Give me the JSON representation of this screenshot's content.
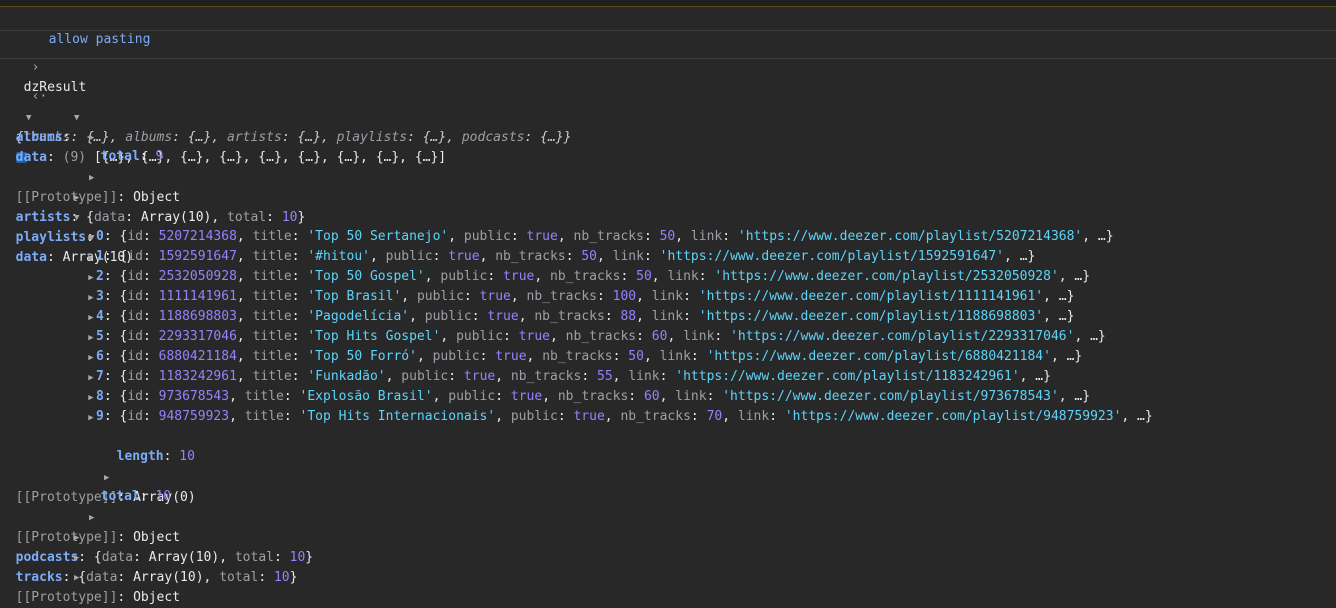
{
  "console": {
    "line1": "allow pasting",
    "line2": "dzResult",
    "summary": {
      "tracks_key": "tracks",
      "albums_key": "albums",
      "artists_key": "artists",
      "playlists_key": "playlists",
      "podcasts_key": "podcasts",
      "ellipsis": "{…}"
    },
    "albums": {
      "key": "albums",
      "data_count": "(9)",
      "data_preview": "[{…}, {…}, {…}, {…}, {…}, {…}, {…}, {…}, {…}]",
      "total": "9"
    },
    "artists": {
      "key": "artists",
      "preview_data": "Array(10)",
      "total": "10"
    },
    "playlists": {
      "key": "playlists",
      "data_label": "Array(10)",
      "items": [
        {
          "idx": "0",
          "id": "5207214368",
          "title": "'Top 50 Sertanejo'",
          "public": "true",
          "nb": "50",
          "link": "'https://www.deezer.com/playlist/5207214368'"
        },
        {
          "idx": "1",
          "id": "1592591647",
          "title": "'#hitou'",
          "public": "true",
          "nb": "50",
          "link": "'https://www.deezer.com/playlist/1592591647'"
        },
        {
          "idx": "2",
          "id": "2532050928",
          "title": "'Top 50 Gospel'",
          "public": "true",
          "nb": "50",
          "link": "'https://www.deezer.com/playlist/2532050928'"
        },
        {
          "idx": "3",
          "id": "1111141961",
          "title": "'Top Brasil'",
          "public": "true",
          "nb": "100",
          "link": "'https://www.deezer.com/playlist/1111141961'"
        },
        {
          "idx": "4",
          "id": "1188698803",
          "title": "'Pagodelícia'",
          "public": "true",
          "nb": "88",
          "link": "'https://www.deezer.com/playlist/1188698803'"
        },
        {
          "idx": "5",
          "id": "2293317046",
          "title": "'Top Hits Gospel'",
          "public": "true",
          "nb": "60",
          "link": "'https://www.deezer.com/playlist/2293317046'"
        },
        {
          "idx": "6",
          "id": "6880421184",
          "title": "'Top 50 Forró'",
          "public": "true",
          "nb": "50",
          "link": "'https://www.deezer.com/playlist/6880421184'"
        },
        {
          "idx": "7",
          "id": "1183242961",
          "title": "'Funkadão'",
          "public": "true",
          "nb": "55",
          "link": "'https://www.deezer.com/playlist/1183242961'"
        },
        {
          "idx": "8",
          "id": "973678543",
          "title": "'Explosão Brasil'",
          "public": "true",
          "nb": "60",
          "link": "'https://www.deezer.com/playlist/973678543'"
        },
        {
          "idx": "9",
          "id": "948759923",
          "title": "'Top Hits Internacionais'",
          "public": "true",
          "nb": "70",
          "link": "'https://www.deezer.com/playlist/948759923'"
        }
      ],
      "length": "10",
      "array_proto": "Array(0)",
      "total": "10"
    },
    "podcasts": {
      "key": "podcasts",
      "preview_data": "Array(10)",
      "total": "10"
    },
    "tracks": {
      "key": "tracks",
      "preview_data": "Array(10)",
      "total": "10"
    },
    "prototype_label": "[[Prototype]]",
    "object_label": "Object"
  }
}
